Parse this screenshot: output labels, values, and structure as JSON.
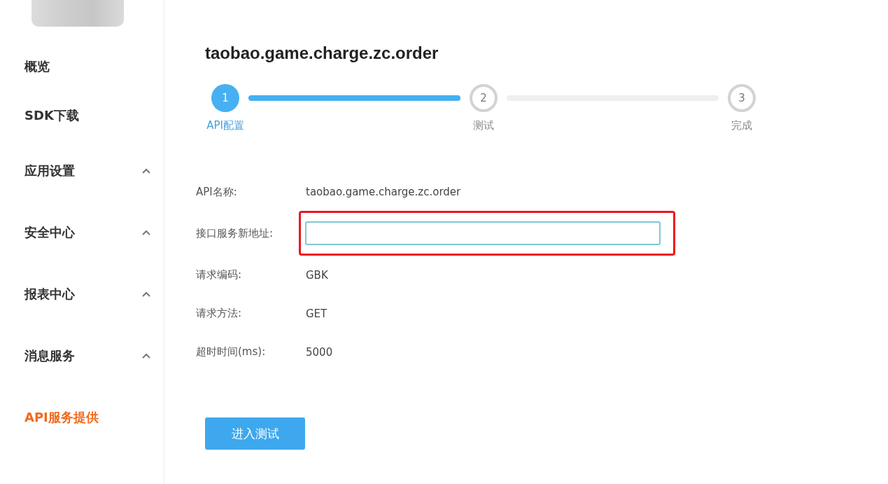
{
  "sidebar": {
    "items": [
      {
        "label": "概览",
        "selected": false
      },
      {
        "label": "SDK下载",
        "selected": false
      },
      {
        "label": "应用设置",
        "selected": false,
        "expanded": true
      },
      {
        "label": "安全中心",
        "selected": false,
        "expanded": true
      },
      {
        "label": "报表中心",
        "selected": false,
        "expanded": true
      },
      {
        "label": "消息服务",
        "selected": false,
        "expanded": true
      },
      {
        "label": "API服务提供",
        "selected": true
      }
    ]
  },
  "page": {
    "title": "taobao.game.charge.zc.order"
  },
  "steps": [
    {
      "number": "1",
      "label": "API配置",
      "selected": true
    },
    {
      "number": "2",
      "label": "测试",
      "selected": false
    },
    {
      "number": "3",
      "label": "完成",
      "selected": false
    }
  ],
  "connectors": [
    {
      "level": 1
    },
    {
      "level": 0
    }
  ],
  "form": [
    {
      "kind": "text",
      "label": "API名称:",
      "value": "taobao.game.charge.zc.order"
    },
    {
      "kind": "input",
      "label": "接口服务新地址:",
      "highlighted": true
    },
    {
      "kind": "text",
      "label": "请求编码:",
      "value": "GBK"
    },
    {
      "kind": "text",
      "label": "请求方法:",
      "value": "GET"
    },
    {
      "kind": "text",
      "label": "超时时间(ms):",
      "value": "5000"
    }
  ],
  "button": "进入测试"
}
